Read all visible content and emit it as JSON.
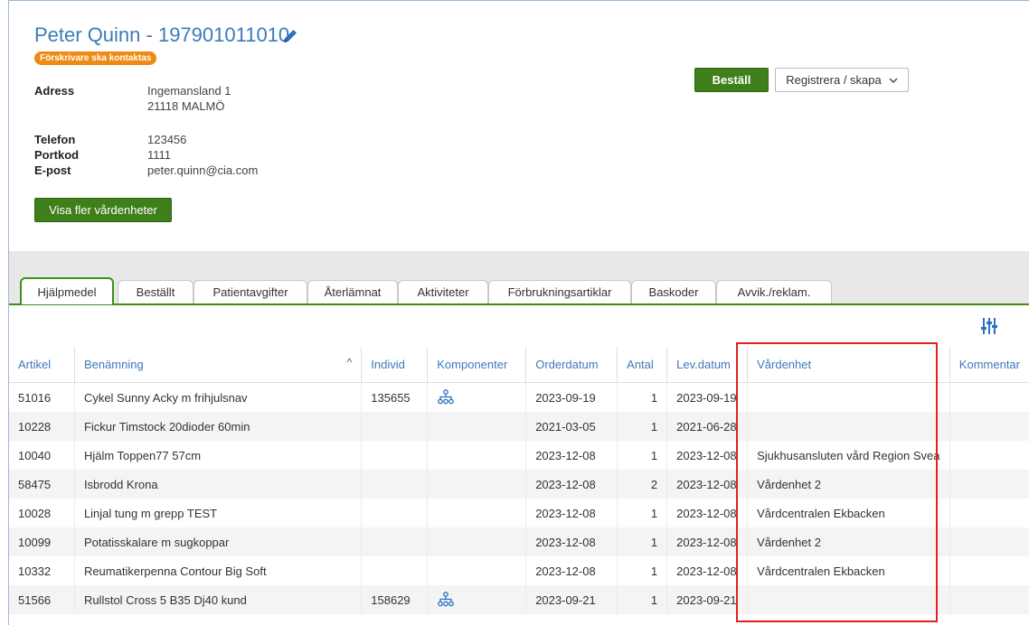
{
  "patient": {
    "title": "Peter Quinn - 197901011010",
    "badge": "Förskrivare ska kontaktas",
    "address_label": "Adress",
    "address_line1": "Ingemansland 1",
    "address_line2": "21118 MALMÖ",
    "phone_label": "Telefon",
    "phone": "123456",
    "portcode_label": "Portkod",
    "portcode": "1111",
    "email_label": "E-post",
    "email": "peter.quinn@cia.com",
    "more_units_label": "Visa fler vårdenheter"
  },
  "actions": {
    "order_label": "Beställ",
    "register_label": "Registrera / skapa"
  },
  "tabs": [
    {
      "label": "Hjälpmedel",
      "active": true
    },
    {
      "label": "Beställt"
    },
    {
      "label": "Patientavgifter"
    },
    {
      "label": "Återlämnat"
    },
    {
      "label": "Aktiviteter"
    },
    {
      "label": "Förbrukningsartiklar"
    },
    {
      "label": "Baskoder"
    },
    {
      "label": "Avvik./reklam."
    }
  ],
  "table": {
    "headers": [
      "Artikel",
      "Benämning",
      "Individ",
      "Komponenter",
      "Orderdatum",
      "Antal",
      "Lev.datum",
      "Vårdenhet",
      "Kommentar"
    ],
    "rows": [
      {
        "artikel": "51016",
        "benamning": "Cykel Sunny Acky m frihjulsnav",
        "individ": "135655",
        "komponenter": true,
        "orderdatum": "2023-09-19",
        "antal": "1",
        "levdatum": "2023-09-19",
        "vardenhet": "",
        "kommentar": ""
      },
      {
        "artikel": "10228",
        "benamning": "Fickur Timstock 20dioder 60min",
        "individ": "",
        "komponenter": false,
        "orderdatum": "2021-03-05",
        "antal": "1",
        "levdatum": "2021-06-28",
        "vardenhet": "",
        "kommentar": ""
      },
      {
        "artikel": "10040",
        "benamning": "Hjälm Toppen77 57cm",
        "individ": "",
        "komponenter": false,
        "orderdatum": "2023-12-08",
        "antal": "1",
        "levdatum": "2023-12-08",
        "vardenhet": "Sjukhusansluten vård Region Svea",
        "kommentar": ""
      },
      {
        "artikel": "58475",
        "benamning": "Isbrodd Krona",
        "individ": "",
        "komponenter": false,
        "orderdatum": "2023-12-08",
        "antal": "2",
        "levdatum": "2023-12-08",
        "vardenhet": "Vårdenhet 2",
        "kommentar": ""
      },
      {
        "artikel": "10028",
        "benamning": "Linjal tung m grepp TEST",
        "individ": "",
        "komponenter": false,
        "orderdatum": "2023-12-08",
        "antal": "1",
        "levdatum": "2023-12-08",
        "vardenhet": "Vårdcentralen Ekbacken",
        "kommentar": ""
      },
      {
        "artikel": "10099",
        "benamning": "Potatisskalare m sugkoppar",
        "individ": "",
        "komponenter": false,
        "orderdatum": "2023-12-08",
        "antal": "1",
        "levdatum": "2023-12-08",
        "vardenhet": "Vårdenhet 2",
        "kommentar": ""
      },
      {
        "artikel": "10332",
        "benamning": "Reumatikerpenna Contour Big Soft",
        "individ": "",
        "komponenter": false,
        "orderdatum": "2023-12-08",
        "antal": "1",
        "levdatum": "2023-12-08",
        "vardenhet": "Vårdcentralen Ekbacken",
        "kommentar": ""
      },
      {
        "artikel": "51566",
        "benamning": "Rullstol Cross 5 B35 Dj40 kund",
        "individ": "158629",
        "komponenter": true,
        "orderdatum": "2023-09-21",
        "antal": "1",
        "levdatum": "2023-09-21",
        "vardenhet": "",
        "kommentar": ""
      }
    ]
  },
  "icons": {
    "edit": "pencil-icon",
    "filter": "column-settings-icon",
    "components": "hierarchy-icon"
  },
  "colors": {
    "accent": "#3d7ab8",
    "button_green": "#3f7f1a",
    "badge_orange": "#ef8a12",
    "highlight_red": "#e32020"
  }
}
